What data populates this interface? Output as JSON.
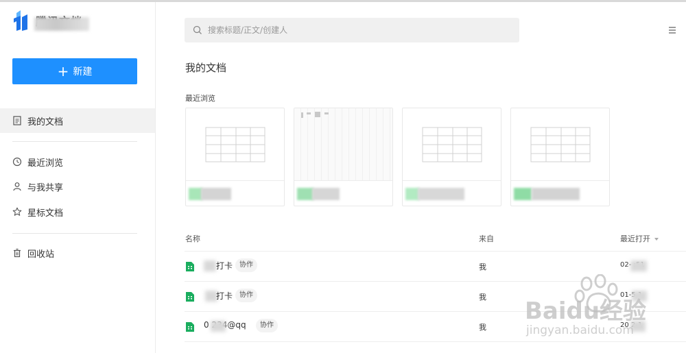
{
  "app": {
    "logo_text": "腾讯文档"
  },
  "sidebar": {
    "new_button_label": "新建",
    "items": [
      {
        "label": "我的文档",
        "icon": "doc-icon",
        "active": true
      },
      {
        "label": "最近浏览",
        "icon": "clock-icon"
      },
      {
        "label": "与我共享",
        "icon": "user-icon"
      },
      {
        "label": "星标文档",
        "icon": "star-icon"
      },
      {
        "label": "回收站",
        "icon": "trash-icon"
      }
    ]
  },
  "search": {
    "placeholder": "搜索标题/正文/创建人"
  },
  "main": {
    "title": "我的文档",
    "recent_label": "最近浏览"
  },
  "table": {
    "headers": {
      "name": "名称",
      "from": "来自",
      "opened": "最近打开"
    },
    "rows": [
      {
        "name": "打卡",
        "tag": "协作",
        "from": "我",
        "opened": "02-  :51"
      },
      {
        "name": "打卡",
        "tag": "协作",
        "from": "我",
        "opened": "01-5  1"
      },
      {
        "name": "0 234@qq",
        "tag": "协作",
        "from": "我",
        "opened": "20  2-1"
      }
    ]
  },
  "watermark": {
    "brand": "Baidu经验",
    "url": "jingyan.baidu.com"
  },
  "colors": {
    "accent": "#1e90ff",
    "sheet_green": "#1aad5e"
  }
}
